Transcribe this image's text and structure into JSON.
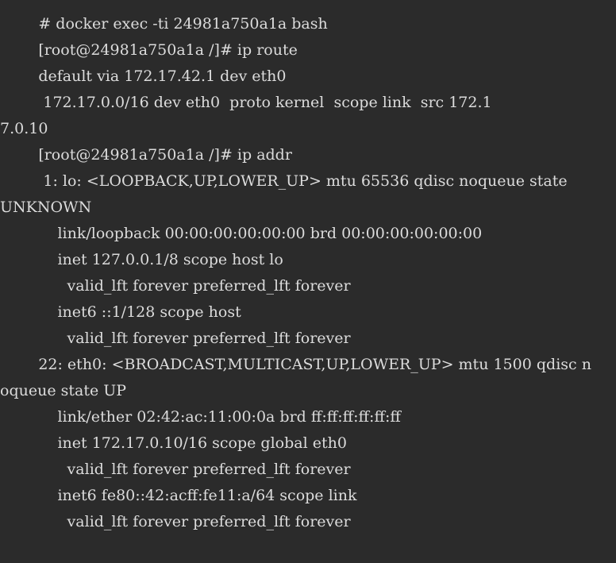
{
  "terminal": {
    "lines": [
      "        # docker exec -ti 24981a750a1a bash",
      "        [root@24981a750a1a /]# ip route",
      "        default via 172.17.42.1 dev eth0",
      "         172.17.0.0/16 dev eth0  proto kernel  scope link  src 172.1",
      "7.0.10",
      "        [root@24981a750a1a /]# ip addr",
      "         1: lo: <LOOPBACK,UP,LOWER_UP> mtu 65536 qdisc noqueue state",
      "UNKNOWN",
      "            link/loopback 00:00:00:00:00:00 brd 00:00:00:00:00:00",
      "            inet 127.0.0.1/8 scope host lo",
      "              valid_lft forever preferred_lft forever",
      "            inet6 ::1/128 scope host",
      "              valid_lft forever preferred_lft forever",
      "        22: eth0: <BROADCAST,MULTICAST,UP,LOWER_UP> mtu 1500 qdisc n",
      "oqueue state UP",
      "            link/ether 02:42:ac:11:00:0a brd ff:ff:ff:ff:ff:ff",
      "            inet 172.17.0.10/16 scope global eth0",
      "              valid_lft forever preferred_lft forever",
      "            inet6 fe80::42:acff:fe11:a/64 scope link",
      "              valid_lft forever preferred_lft forever"
    ]
  }
}
